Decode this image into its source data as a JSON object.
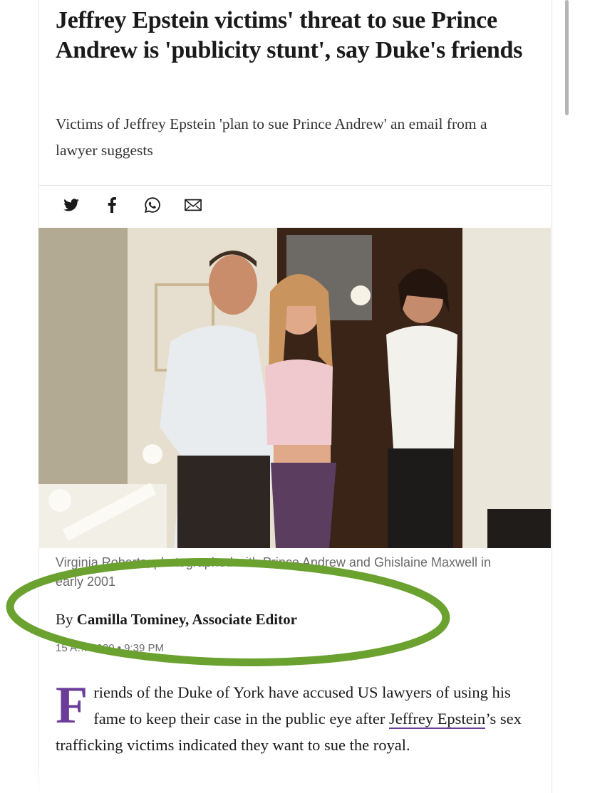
{
  "article": {
    "headline": "Jeffrey Epstein victims' threat to sue Prince Andrew is 'publicity stunt', say Duke's friends",
    "standfirst": "Victims of Jeffrey Epstein 'plan to sue Prince Andrew' an email from a lawyer suggests",
    "share": {
      "icons": [
        "twitter-icon",
        "facebook-icon",
        "whatsapp-icon",
        "email-icon"
      ]
    },
    "photo": {
      "description_visible": false
    },
    "caption": "Virginia Roberts, photographed with Prince Andrew and Ghislaine Maxwell in early 2001",
    "caption_visible_fragments": [
      "Virginia R",
      "Andrew and Ghislaine",
      "xwell in early 2001"
    ],
    "byline": {
      "prefix": "By",
      "author": "Camilla Tominey, Associate Editor"
    },
    "dateline": "15 A… 2020 • 9:39 PM",
    "body": {
      "dropcap": "F",
      "intro": "riends of the Duke of York have accused US lawyers of using his fame to keep their case in the public eye after ",
      "link_text": "Jeffrey Epstein",
      "after_link": "’s sex trafficking victims indicated they want to sue the royal."
    }
  },
  "colors": {
    "accent_purple": "#6b3d99",
    "annotation_green": "#6aa12f",
    "caption_grey": "#6b6b6b"
  }
}
